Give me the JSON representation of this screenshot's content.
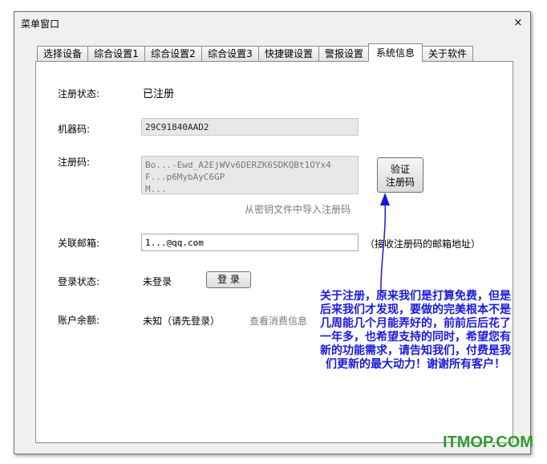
{
  "window": {
    "title": "菜单窗口",
    "close_label": "×"
  },
  "tabs": [
    "选择设备",
    "综合设置1",
    "综合设置2",
    "综合设置3",
    "快捷键设置",
    "警报设置",
    "系统信息",
    "关于软件"
  ],
  "form": {
    "reg_status_label": "注册状态:",
    "reg_status_value": "已注册",
    "machine_code_label": "机器码:",
    "machine_code_value": "29C91840AAD2",
    "reg_code_label": "注册码:",
    "reg_code_line1": "Bo...-Ewd_A2EjWVv6DERZK6SDKQBt1OYx4",
    "reg_code_line2": "F...p6MybAyC6GP",
    "reg_code_line3": "M...",
    "verify_button": "验证\n注册码",
    "import_link": "从密钥文件中导入注册码",
    "email_label": "关联邮箱:",
    "email_value": "1...@qq.com",
    "email_hint": "（接收注册码的邮箱地址）",
    "login_status_label": "登录状态:",
    "login_status_value": "未登录",
    "login_button": "登 录",
    "balance_label": "账户余额:",
    "balance_value": "未知（请先登录）",
    "consume_link": "查看消费信息"
  },
  "annotation": {
    "text": "关于注册，原来我们是打算免费，但是后来我们才发现，要做的完美根本不是几周能几个月能弄好的，前前后后花了一年多，也希望支持的同时，希望您有新的功能需求，请告知我们，付费是我们更新的最大动力！谢谢所有客户！"
  },
  "watermark": "ITMOP.COM",
  "colors": {
    "annotation": "#1a1adc",
    "watermark": "#2f9a2f"
  }
}
